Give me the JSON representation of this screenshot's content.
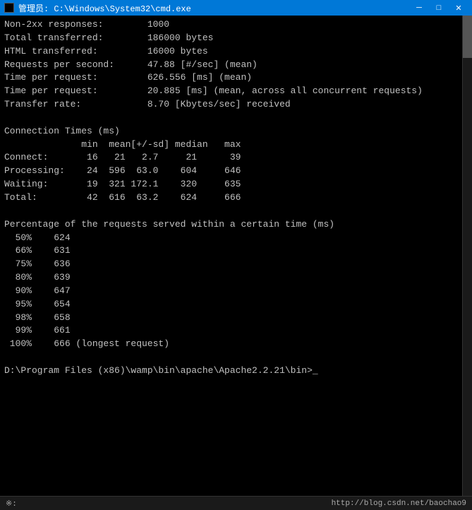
{
  "titleBar": {
    "title": "管理员: C:\\Windows\\System32\\cmd.exe",
    "minimizeLabel": "─",
    "maximizeLabel": "□",
    "closeLabel": "✕"
  },
  "terminal": {
    "lines": [
      "Non-2xx responses:        1000",
      "Total transferred:        186000 bytes",
      "HTML transferred:         16000 bytes",
      "Requests per second:      47.88 [#/sec] (mean)",
      "Time per request:         626.556 [ms] (mean)",
      "Time per request:         20.885 [ms] (mean, across all concurrent requests)",
      "Transfer rate:            8.70 [Kbytes/sec] received",
      "",
      "Connection Times (ms)",
      "              min  mean[+/-sd] median   max",
      "Connect:       16   21   2.7     21      39",
      "Processing:    24  596  63.0    604     646",
      "Waiting:       19  321 172.1    320     635",
      "Total:         42  616  63.2    624     666",
      "",
      "Percentage of the requests served within a certain time (ms)",
      "  50%    624",
      "  66%    631",
      "  75%    636",
      "  80%    639",
      "  90%    647",
      "  95%    654",
      "  98%    658",
      "  99%    661",
      " 100%    666 (longest request)",
      "",
      "D:\\Program Files (x86)\\wamp\\bin\\apache\\Apache2.2.21\\bin>_"
    ]
  },
  "statusBar": {
    "left": "※:",
    "right": "http://blog.csdn.net/baochao9"
  }
}
